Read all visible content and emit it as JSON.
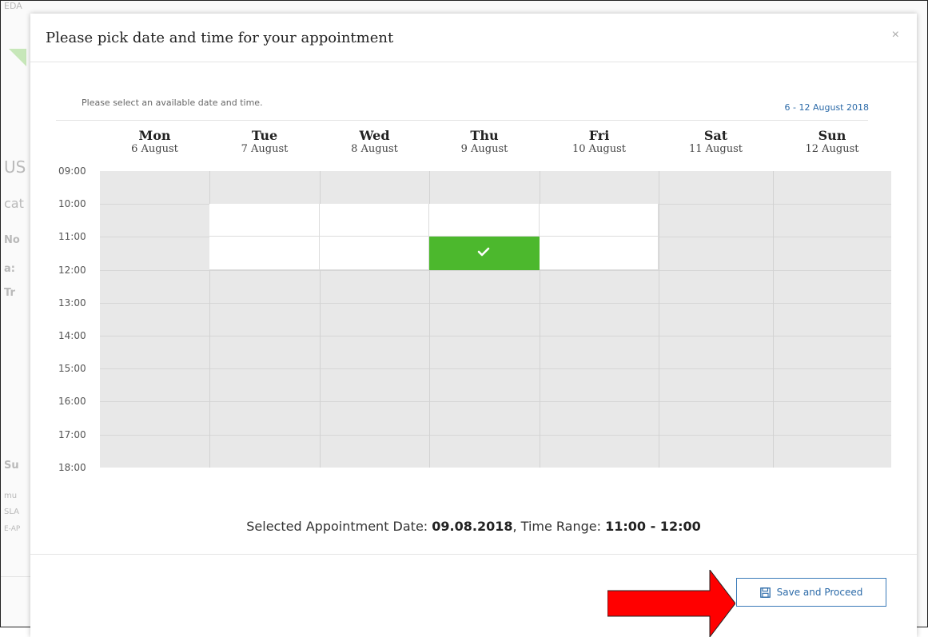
{
  "background": {
    "fragments": [
      "EDA",
      "US",
      "cat",
      "No",
      "a:",
      "Tr",
      "Su",
      "mu",
      "SLA",
      "E-AP"
    ]
  },
  "modal": {
    "title": "Please pick date and time for your appointment",
    "close_icon": "close-icon"
  },
  "calendar": {
    "instruction": "Please select an available date and time.",
    "week_range": "6 - 12 August 2018",
    "days": [
      {
        "name": "Mon",
        "date": "6 August"
      },
      {
        "name": "Tue",
        "date": "7 August"
      },
      {
        "name": "Wed",
        "date": "8 August"
      },
      {
        "name": "Thu",
        "date": "9 August"
      },
      {
        "name": "Fri",
        "date": "10 August"
      },
      {
        "name": "Sat",
        "date": "11 August"
      },
      {
        "name": "Sun",
        "date": "12 August"
      }
    ],
    "times": [
      "09:00",
      "10:00",
      "11:00",
      "12:00",
      "13:00",
      "14:00",
      "15:00",
      "16:00",
      "17:00",
      "18:00"
    ],
    "available_slots": [
      {
        "day": "Tue",
        "time": "10:00"
      },
      {
        "day": "Tue",
        "time": "11:00"
      },
      {
        "day": "Wed",
        "time": "10:00"
      },
      {
        "day": "Wed",
        "time": "11:00"
      },
      {
        "day": "Thu",
        "time": "10:00"
      },
      {
        "day": "Thu",
        "time": "11:00",
        "selected": true
      },
      {
        "day": "Fri",
        "time": "10:00"
      },
      {
        "day": "Fri",
        "time": "11:00"
      }
    ],
    "colors": {
      "available": "#ffffff",
      "unavailable": "#e8e8e8",
      "selected": "#4cb82d"
    }
  },
  "summary": {
    "date_label": "Selected Appointment Date: ",
    "date_value": "09.08.2018",
    "range_label": ", Time Range: ",
    "range_value": "11:00 - 12:00"
  },
  "footer": {
    "save_label": "Save and Proceed",
    "save_icon": "floppy-disk-icon",
    "annotation_arrow_color": "#ff0000"
  }
}
